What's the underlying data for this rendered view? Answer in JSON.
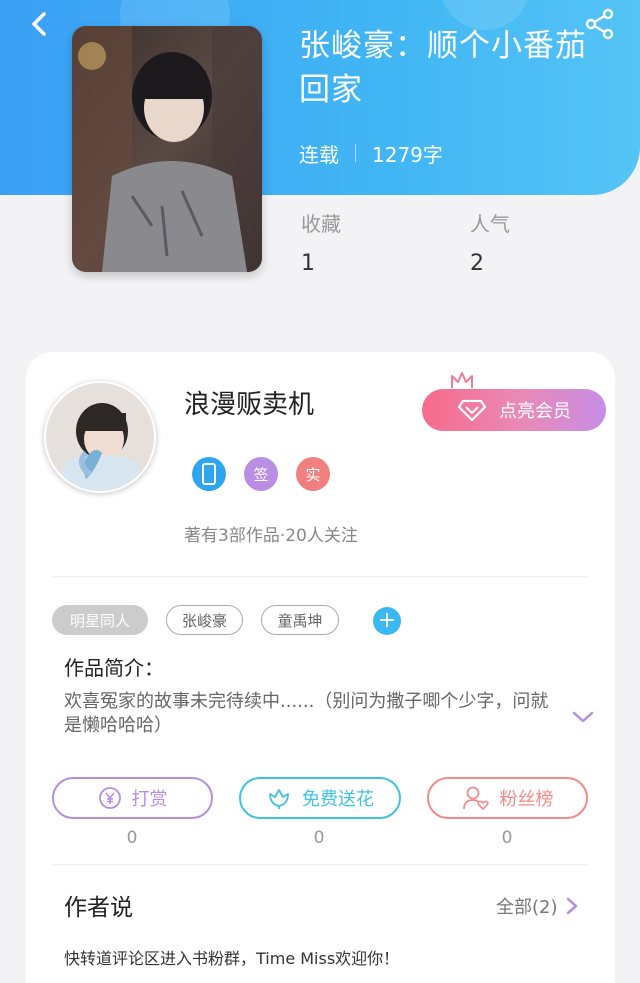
{
  "book": {
    "title": "张峻豪：顺个小番茄回家",
    "status": "连载",
    "word_count": "1279字",
    "stats": [
      {
        "label": "收藏",
        "value": "1"
      },
      {
        "label": "人气",
        "value": "2"
      }
    ]
  },
  "author": {
    "name": "浪漫贩卖机",
    "badges": [
      {
        "icon": "phone-icon",
        "label": "",
        "color": "#2fa5f0"
      },
      {
        "icon": "sign-icon",
        "label": "签",
        "color": "#b98ee3"
      },
      {
        "icon": "real-name-icon",
        "label": "实",
        "color": "#f08080"
      }
    ],
    "works_info": "著有3部作品·20人关注",
    "vip_button": "点亮会员"
  },
  "tags": {
    "category": "明星同人",
    "items": [
      "张峻豪",
      "童禹坤"
    ]
  },
  "intro": {
    "title": "作品简介：",
    "text": "欢喜冤家的故事未完待续中......（别问为撒子唧个少字，问就是懒哈哈哈）"
  },
  "actions": [
    {
      "label": "打赏",
      "icon": "yen-icon",
      "count": "0",
      "color": "#b48fe0"
    },
    {
      "label": "免费送花",
      "icon": "flower-icon",
      "count": "0",
      "color": "#3ec4df"
    },
    {
      "label": "粉丝榜",
      "icon": "fan-icon",
      "count": "0",
      "color": "#f28a8a"
    }
  ],
  "author_says": {
    "title": "作者说",
    "all_label": "全部",
    "all_count": "(2)",
    "notice": "快转道评论区进入书粉群，Time Miss欢迎你！"
  },
  "colors": {
    "header_blue": "#3aa0f5",
    "accent_pink": "#f76b8a",
    "accent_purple": "#c68de6",
    "chevron_purple": "#b48fe0"
  }
}
